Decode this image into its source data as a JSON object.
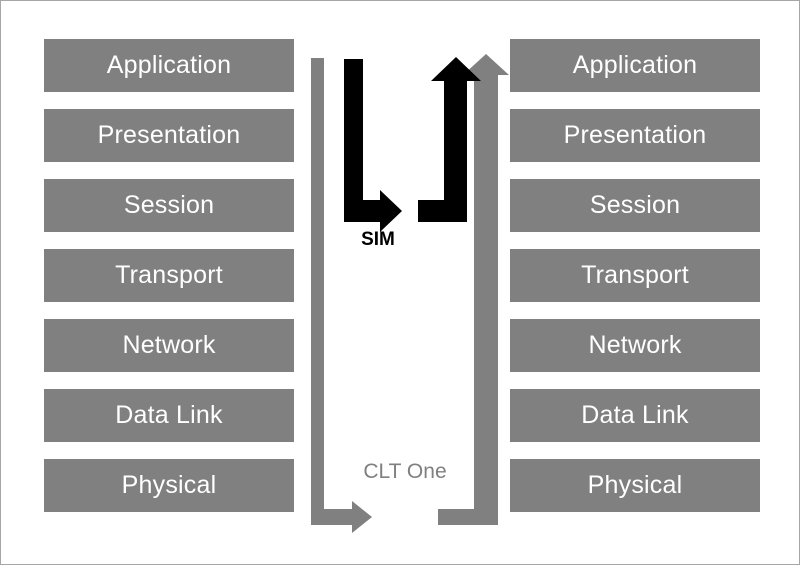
{
  "diagram": {
    "title": "OSI layer stacks with SIM and CLT One interconnect arrows",
    "background_color": "#ffffff",
    "border_color": "#a6a6a6",
    "box_color": "#808080",
    "box_text_color": "#ffffff",
    "arrow_black_color": "#000000",
    "arrow_gray_color": "#808080"
  },
  "left_stack": {
    "name": "left-osi-stack",
    "layers": [
      {
        "label": "Application"
      },
      {
        "label": "Presentation"
      },
      {
        "label": "Session"
      },
      {
        "label": "Transport"
      },
      {
        "label": "Network"
      },
      {
        "label": "Data Link"
      },
      {
        "label": "Physical"
      }
    ]
  },
  "right_stack": {
    "name": "right-osi-stack",
    "layers": [
      {
        "label": "Application"
      },
      {
        "label": "Presentation"
      },
      {
        "label": "Session"
      },
      {
        "label": "Transport"
      },
      {
        "label": "Network"
      },
      {
        "label": "Data Link"
      },
      {
        "label": "Physical"
      }
    ]
  },
  "annotations": {
    "sim_label": "SIM",
    "clt_label": "CLT One"
  },
  "arrows": [
    {
      "name": "sim-downlink-arrow",
      "color": "#000000",
      "direction": "down-then-right",
      "from_layer": "Application",
      "to_label": "SIM"
    },
    {
      "name": "sim-uplink-arrow",
      "color": "#000000",
      "direction": "right-then-up",
      "from_label": "SIM",
      "to_layer": "Application"
    },
    {
      "name": "clt-one-downlink-arrow",
      "color": "#808080",
      "direction": "down-then-right",
      "from_layer": "Application",
      "to_label": "CLT One"
    },
    {
      "name": "clt-one-uplink-arrow",
      "color": "#808080",
      "direction": "right-then-up",
      "from_label": "CLT One",
      "to_layer": "Application"
    }
  ]
}
